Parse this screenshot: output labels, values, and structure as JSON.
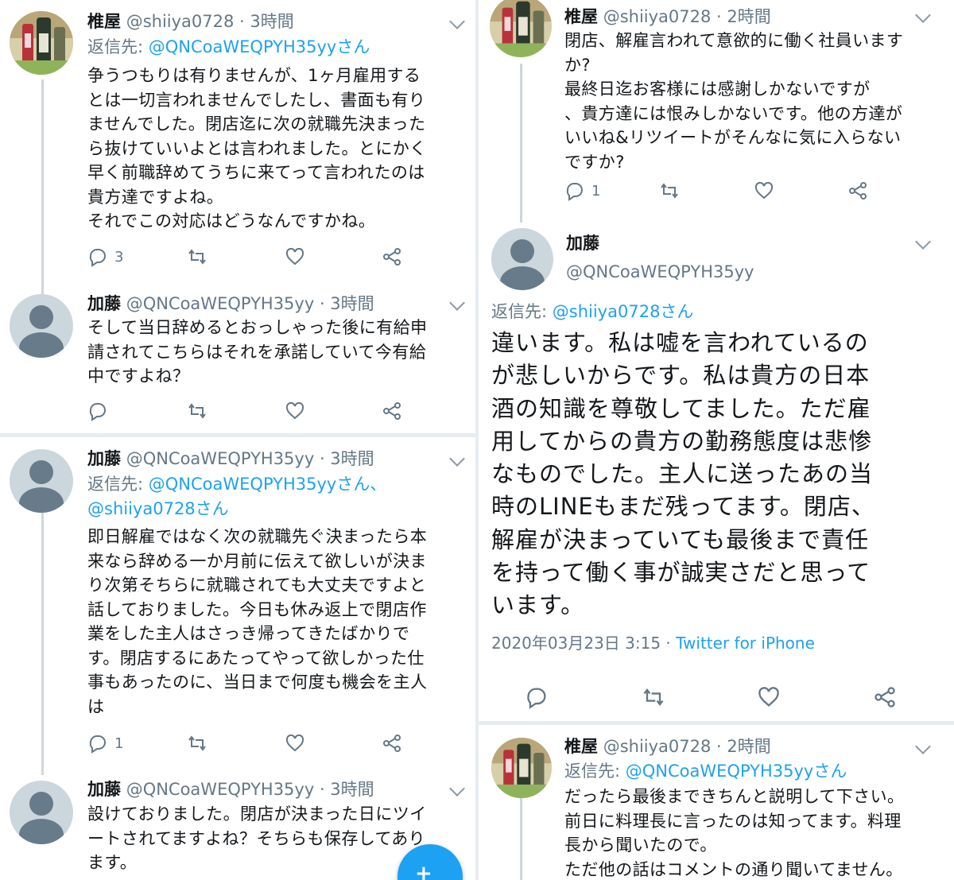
{
  "left_column": {
    "tweets": [
      {
        "name": "椎屋",
        "handle": "@shiiya0728",
        "time": "· 3時間",
        "reply_prefix": "返信先:",
        "reply_to_line1": "@QNCoaWEQPYH35yyさん",
        "text": "争うつもりは有りませんが、1ヶ月雇用する\nとは一切言われませんでしたし、書面も有り\nませんでした。閉店迄に次の就職先決まった\nら抜けていいよとは言われました。とにかく\n早く前職辞めてうちに来てって言われたのは\n貴方達ですよね。\nそれでこの対応はどうなんですかね。",
        "reply_count": "3",
        "retweet_count": "",
        "like_count": ""
      },
      {
        "name": "加藤",
        "handle": "@QNCoaWEQPYH35yy",
        "time": "· 3時間",
        "text": "そして当日辞めるとおっしゃった後に有給申\n請されてこちらはそれを承諾していて今有給\n中ですよね？",
        "reply_count": "",
        "retweet_count": "",
        "like_count": ""
      },
      {
        "name": "加藤",
        "handle": "@QNCoaWEQPYH35yy",
        "time": "· 3時間",
        "reply_prefix": "返信先:",
        "reply_to_line1": "@QNCoaWEQPYH35yyさん、",
        "reply_to_line2": "@shiiya0728さん",
        "text": "即日解雇ではなく次の就職先ぐ決まったら本\n来なら辞める一か月前に伝えて欲しいが決ま\nり次第そちらに就職されても大丈夫ですよと\n話しておりました。今日も休み返上で閉店作\n業をした主人はさっき帰ってきたばかりで\nす。閉店するにあたってやって欲しかった仕\n事もあったのに、当日まで何度も機会を主人\nは",
        "reply_count": "1",
        "retweet_count": "",
        "like_count": ""
      },
      {
        "name": "加藤",
        "handle": "@QNCoaWEQPYH35yy",
        "time": "· 3時間",
        "text": "設けておりました。閉店が決まった日にツイ\nートされてますよね？そちらも保存してあり\nます。"
      }
    ]
  },
  "right_column": {
    "tweet_top": {
      "name": "椎屋",
      "handle": "@shiiya0728",
      "time": "· 2時間",
      "text": "閉店、解雇言われて意欲的に働く社員います\nか?\n最終日迄お客様には感謝しかないですが\n、貴方達には恨みしかないです。他の方達が\nいいね&リツイートがそんなに気に入らない\nですか?",
      "reply_count": "1",
      "retweet_count": "",
      "like_count": ""
    },
    "focused": {
      "name": "加藤",
      "handle": "@QNCoaWEQPYH35yy",
      "reply_prefix": "返信先:",
      "reply_to": "@shiiya0728さん",
      "text": "違います。私は嘘を言われているの\nが悲しいからです。私は貴方の日本\n酒の知識を尊敬してました。ただ雇\n用してからの貴方の勤務態度は悲惨\nなものでした。主人に送ったあの当\n時のLINEもまだ残ってます。閉店、\n解雇が決まっていても最後まで責任\nを持って働く事が誠実さだと思って\nいます。",
      "timestamp": "2020年03月23日 3:15 · ",
      "source": "Twitter for iPhone"
    },
    "tweet_bottom": {
      "name": "椎屋",
      "handle": "@shiiya0728",
      "time": "· 2時間",
      "reply_prefix": "返信先:",
      "reply_to": "@QNCoaWEQPYH35yyさん",
      "text": "だったら最後まできちんと説明して下さい。\n前日に料理長に言ったのは知ってます。料理\n長から聞いたので。\nただ他の話はコメントの通り聞いてません。"
    }
  },
  "fab": {
    "icon": "compose-icon",
    "plus": "+"
  },
  "colors": {
    "accent": "#1da1f2",
    "muted": "#657786",
    "separator": "#e6ecf0",
    "thread_line": "#ccd6dd"
  }
}
